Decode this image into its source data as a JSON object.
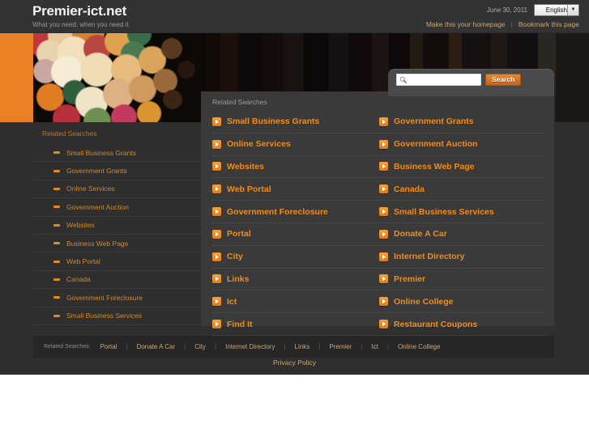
{
  "header": {
    "brand_title": "Premier-ict.net",
    "tagline": "What you need, when you need it",
    "date": "June 30, 2011",
    "language_selected": "English",
    "homepage_link": "Make this your homepage",
    "separator": "|",
    "bookmark_link": "Bookmark this page"
  },
  "search": {
    "value": "",
    "placeholder": "",
    "button_label": "Search",
    "icon": "search-icon"
  },
  "main": {
    "title": "Related Searches",
    "rows": [
      {
        "left": "Small Business Grants",
        "right": "Government Grants"
      },
      {
        "left": "Online Services",
        "right": "Government Auction"
      },
      {
        "left": "Websites",
        "right": "Business Web Page"
      },
      {
        "left": "Web Portal",
        "right": "Canada"
      },
      {
        "left": "Government Foreclosure",
        "right": "Small Business Services"
      },
      {
        "left": "Portal",
        "right": "Donate A Car"
      },
      {
        "left": "City",
        "right": "Internet Directory"
      },
      {
        "left": "Links",
        "right": "Premier"
      },
      {
        "left": "Ict",
        "right": "Online College"
      },
      {
        "left": "Find It",
        "right": "Restaurant Coupons"
      }
    ]
  },
  "sidebar": {
    "title": "Related Searches",
    "items": [
      "Small Business Grants",
      "Government Grants",
      "Online Services",
      "Government Auction",
      "Websites",
      "Business Web Page",
      "Web Portal",
      "Canada",
      "Government Foreclosure",
      "Small Business Services"
    ]
  },
  "footer": {
    "label": "Related Searches:",
    "links": [
      "Portal",
      "Donate A Car",
      "City",
      "Internet Directory",
      "Links",
      "Premier",
      "Ict",
      "Online College"
    ],
    "privacy": "Privacy Policy"
  },
  "colors": {
    "accent_orange": "#f08c1b",
    "link_tan": "#c8a77a",
    "page_bg": "#2f2f2f",
    "panel_bg": "#3a3a3a",
    "header_bg": "#333333"
  }
}
